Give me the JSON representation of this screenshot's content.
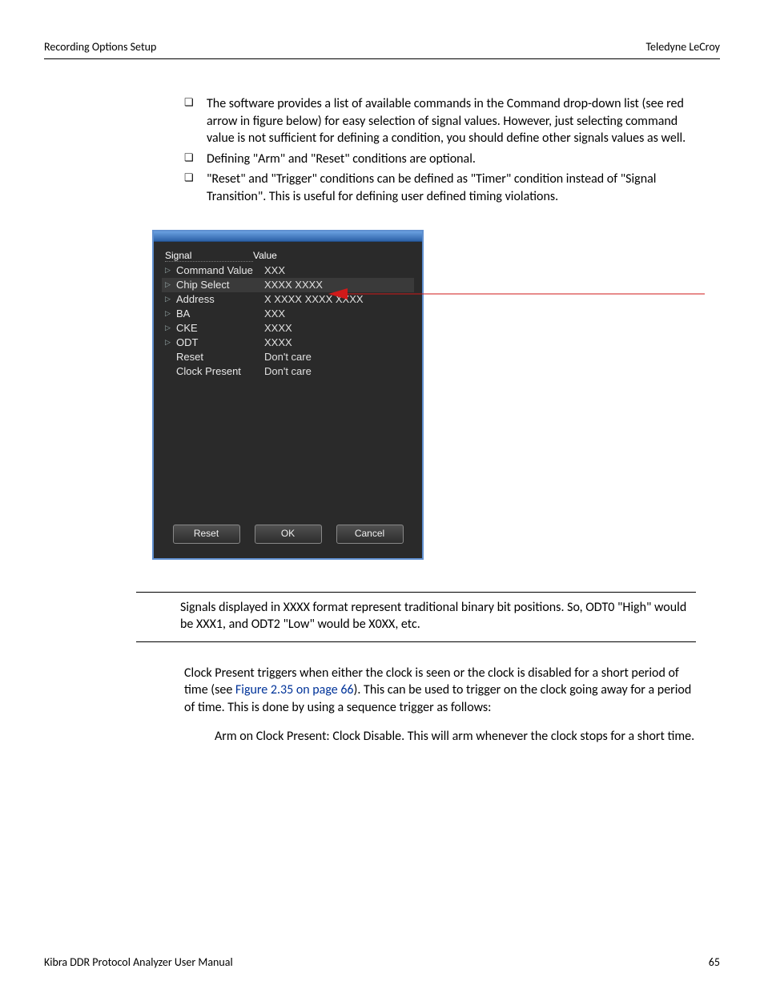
{
  "header": {
    "left": "Recording Options Setup",
    "right": "Teledyne LeCroy"
  },
  "bullets": [
    "The software provides a list of available commands in the Command drop-down list (see red arrow in figure below) for easy selection of signal values. However, just selecting command value is not sufficient for defining a condition, you should define other signals values as well.",
    "Defining \"Arm\" and \"Reset\" conditions are optional.",
    "\"Reset\" and \"Trigger\" conditions can be defined as \"Timer\" condition instead of \"Signal Transition\". This is useful for defining user defined timing violations."
  ],
  "dialog": {
    "col_signal": "Signal",
    "col_value": "Value",
    "rows": [
      {
        "exp": true,
        "sel": false,
        "name": "Command Value",
        "value": "XXX"
      },
      {
        "exp": true,
        "sel": true,
        "name": "Chip Select",
        "value": "XXXX XXXX"
      },
      {
        "exp": true,
        "sel": false,
        "name": "Address",
        "value": "X XXXX XXXX XXXX"
      },
      {
        "exp": true,
        "sel": false,
        "name": "BA",
        "value": "XXX"
      },
      {
        "exp": true,
        "sel": false,
        "name": "CKE",
        "value": "XXXX"
      },
      {
        "exp": true,
        "sel": false,
        "name": "ODT",
        "value": "XXXX"
      },
      {
        "exp": false,
        "sel": false,
        "name": "Reset",
        "value": "Don't care"
      },
      {
        "exp": false,
        "sel": false,
        "name": "Clock Present",
        "value": "Don't care"
      }
    ],
    "buttons": {
      "reset": "Reset",
      "ok": "OK",
      "cancel": "Cancel"
    }
  },
  "note": "Signals displayed in XXXX format represent traditional binary bit positions. So, ODT0 \"High\" would be XXX1, and ODT2 \"Low\" would be X0XX, etc.",
  "clock_para": {
    "before": "Clock Present triggers when either the clock is seen or the clock is disabled for a short period of time (see ",
    "xref": "Figure 2.35 on page 66",
    "after": "). This can be used to trigger on the clock going away for a period of time. This is done by using a sequence trigger as follows:"
  },
  "arm_para": "Arm on Clock Present: Clock Disable. This will arm whenever the clock stops for a short time.",
  "footer": {
    "left": "Kibra DDR Protocol Analyzer User Manual",
    "right": "65"
  }
}
